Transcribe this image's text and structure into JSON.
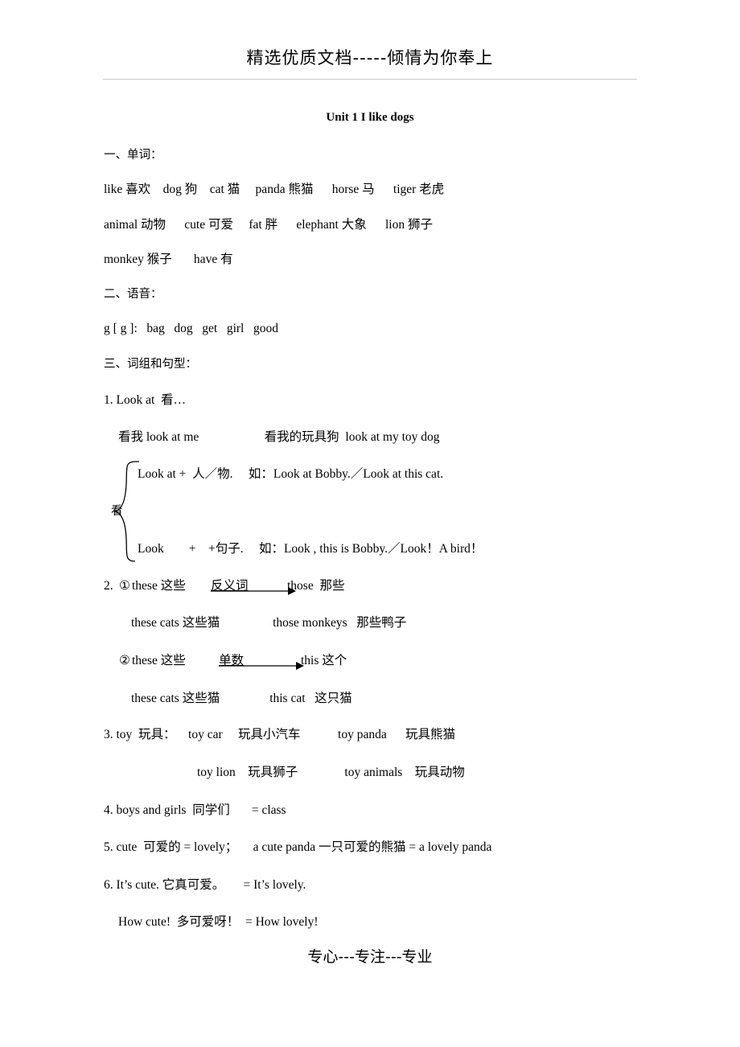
{
  "header": {
    "banner": "精选优质文档-----倾情为你奉上"
  },
  "doc": {
    "title": "Unit 1 I like dogs",
    "sections": [
      {
        "heading": "一、单词："
      },
      {
        "heading": "二、语音："
      },
      {
        "heading": "三、词组和句型："
      }
    ],
    "vocab_lines": [
      "like 喜欢    dog 狗    cat 猫     panda 熊猫      horse 马      tiger 老虎",
      "animal 动物      cute 可爱     fat 胖      elephant 大象      lion 狮子",
      "monkey 猴子       have 有"
    ],
    "phonics_line": "g [ g ]:   bag   dog   get   girl   good",
    "item1": {
      "label": "1. Look at  看…",
      "sub1": "看我 look at me                     看我的玩具狗  look at my toy dog",
      "brace_label": "看",
      "brace_top": "Look at +  人／物.     如：Look at Bobby.／Look at this cat.",
      "brace_bottom": "Look        +    +句子.     如：Look , this is Bobby.／Look！A bird！"
    },
    "item2": {
      "label": "2.",
      "mark1": "①",
      "line1_a": "these 这些",
      "line1_arrow_label": "反义词",
      "line1_b": "those  那些",
      "line1_sub": "these cats 这些猫                 those monkeys   那些鸭子",
      "mark2": "②",
      "line2_a": "these 这些",
      "line2_arrow_label": "单数",
      "line2_b": "this 这个",
      "line2_sub": "these cats 这些猫                this cat   这只猫"
    },
    "item3": {
      "line1": "3. toy  玩具：    toy car     玩具小汽车            toy panda      玩具熊猫",
      "line2": "toy lion    玩具狮子               toy animals    玩具动物"
    },
    "item4": "4. boys and girls  同学们       = class",
    "item5": "5. cute  可爱的 = lovely；     a cute panda 一只可爱的熊猫 = a lovely panda",
    "item6_line1": "6. It’s cute. 它真可爱。      = It’s lovely.",
    "item6_line2": "How cute!  多可爱呀！  = How lovely!"
  },
  "footer": {
    "text": "专心---专注---专业"
  }
}
